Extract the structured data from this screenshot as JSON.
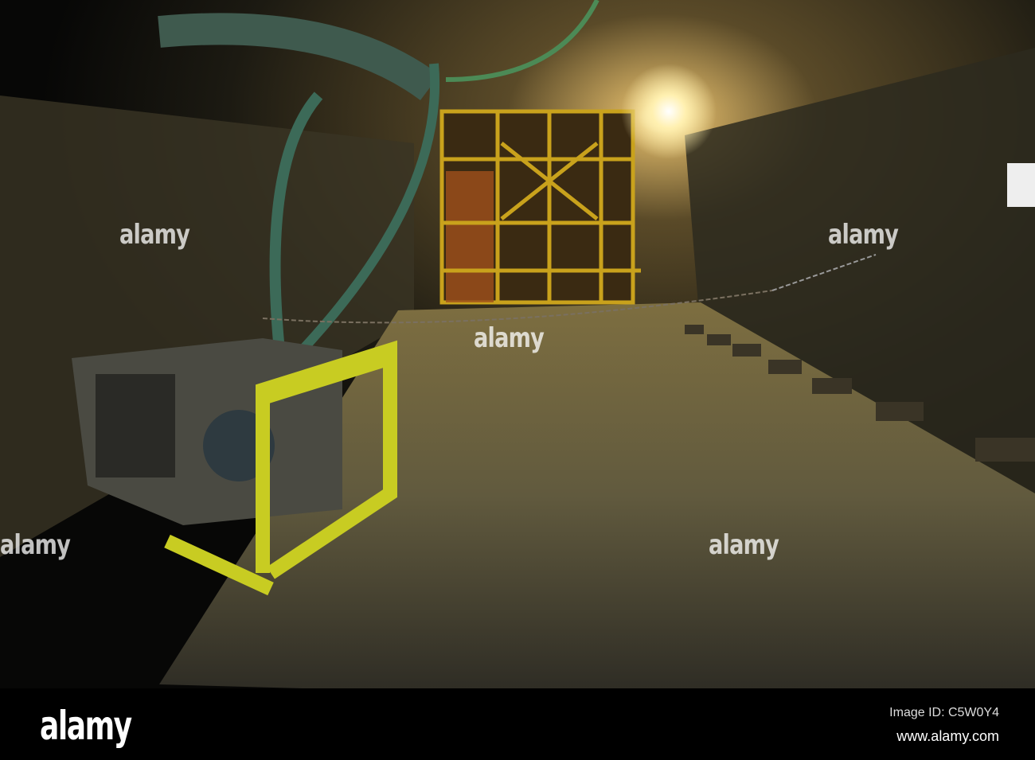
{
  "photo": {
    "subject": "underground mine tunnel with yellow cage gate",
    "accent": "#e6e22a"
  },
  "watermarks": [
    "alamy",
    "alamy",
    "alamy",
    "alamy",
    "alamy"
  ],
  "footer": {
    "logo": "alamy",
    "image_id": "Image ID: C5W0Y4",
    "website": "www.alamy.com"
  }
}
